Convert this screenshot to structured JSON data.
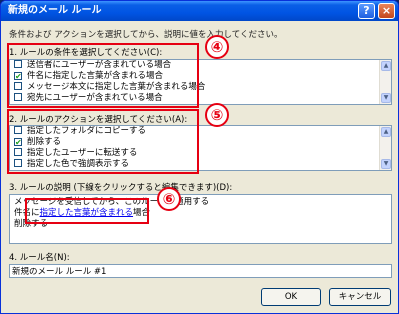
{
  "window": {
    "title": "新規のメール ルール",
    "help_label": "?",
    "close_label": "×"
  },
  "instruction": "条件および アクションを選択してから、説明に値を入力してください。",
  "conditions": {
    "label": "1. ルールの条件を選択してください(C):",
    "items": [
      {
        "text": "送信者にユーザーが含まれている場合",
        "checked": false
      },
      {
        "text": "件名に指定した言葉が含まれる場合",
        "checked": true
      },
      {
        "text": "メッセージ本文に指定した言葉が含まれる場合",
        "checked": false
      },
      {
        "text": "宛先にユーザーが含まれている場合",
        "checked": false
      }
    ]
  },
  "actions": {
    "label": "2. ルールのアクションを選択してください(A):",
    "items": [
      {
        "text": "指定したフォルダにコピーする",
        "checked": false
      },
      {
        "text": "削除する",
        "checked": true
      },
      {
        "text": "指定したユーザーに転送する",
        "checked": false
      },
      {
        "text": "指定した色で強調表示する",
        "checked": false
      }
    ]
  },
  "description": {
    "label": "3. ルールの説明 (下線をクリックすると編集できます)(D):",
    "line1": "メッセージを受信してから、このルールを適用する",
    "line2_prefix": "件名に",
    "link": "指定した言葉が含まれる",
    "line2_suffix": "場合",
    "line3": "削除する"
  },
  "rule_name": {
    "label": "4. ルール名(N):",
    "value": "新規のメール ルール #1"
  },
  "buttons": {
    "ok": "OK",
    "cancel": "キャンセル"
  },
  "annotations": [
    "④",
    "⑤",
    "⑥"
  ],
  "colors": {
    "annotation_red": "#e60012",
    "title_blue": "#0054e3",
    "link_blue": "#0000ee"
  }
}
